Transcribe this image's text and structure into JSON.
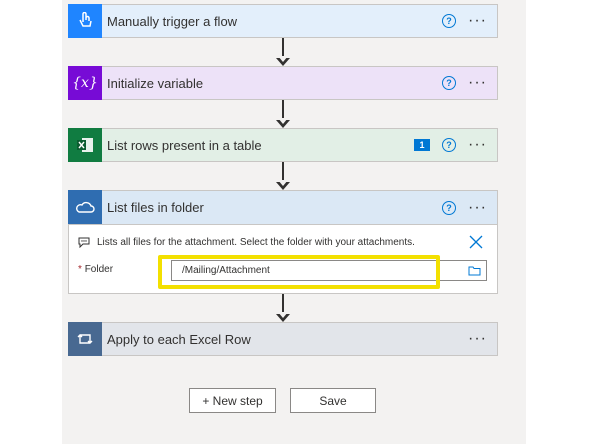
{
  "steps": [
    {
      "title": "Manually trigger a flow",
      "icon": "hand-touch-icon",
      "color": "#1f85ff",
      "bg": "#e3effb"
    },
    {
      "title": "Initialize variable",
      "icon": "variable-icon",
      "color": "#770bd6",
      "bg": "#ede2f8"
    },
    {
      "title": "List rows present in a table",
      "icon": "excel-icon",
      "color": "#107c41",
      "bg": "#e2efe6",
      "badge": "1"
    },
    {
      "title": "List files in folder",
      "icon": "onedrive-icon",
      "color": "#2f6db1",
      "bg": "#dbe8f5"
    },
    {
      "title": "Apply to each Excel Row",
      "icon": "loop-icon",
      "color": "#486991",
      "bg": "#e2e5ea"
    }
  ],
  "expanded": {
    "description": "Lists all files for the attachment. Select the folder with your attachments.",
    "folder_label": "Folder",
    "required_mark": "*",
    "folder_value": "/Mailing/Attachment"
  },
  "buttons": {
    "new_step": "+ New step",
    "save": "Save"
  },
  "colors": {
    "highlight": "#f3e000",
    "accent": "#0078d4"
  }
}
